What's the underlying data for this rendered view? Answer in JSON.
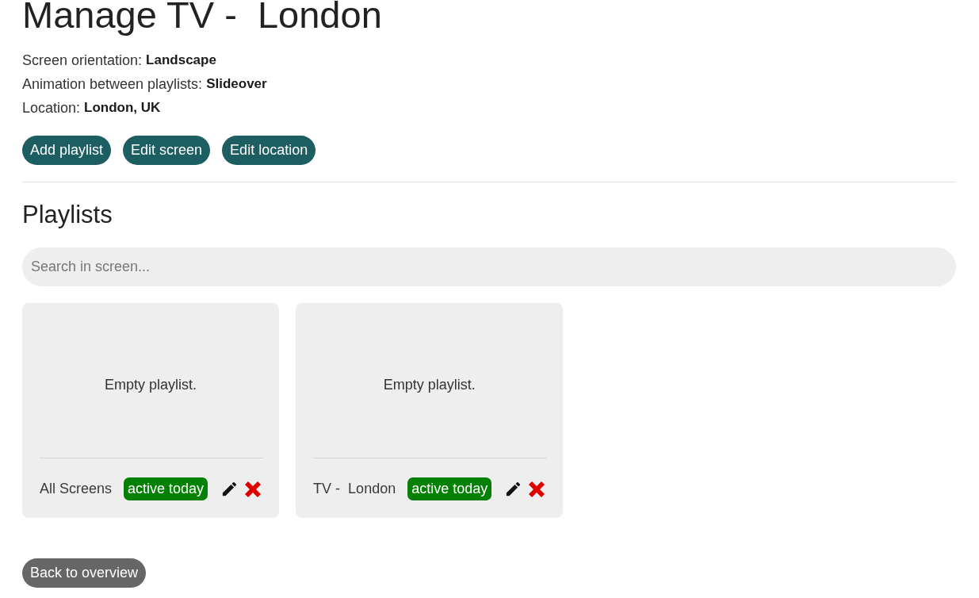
{
  "page": {
    "title": "Manage TV -  London"
  },
  "details": [
    {
      "label": "Screen orientation:",
      "value": "Landscape"
    },
    {
      "label": "Animation between playlists:",
      "value": "Slideover"
    },
    {
      "label": "Location:",
      "value": "London, UK"
    }
  ],
  "actions": [
    "Add playlist",
    "Edit screen",
    "Edit location"
  ],
  "playlists": {
    "heading": "Playlists",
    "search": {
      "placeholder": "Search in screen..."
    },
    "cards": [
      {
        "message": "Empty playlist.",
        "name": "All Screens",
        "badge": "active today"
      },
      {
        "message": "Empty playlist.",
        "name": "TV -  London",
        "badge": "active today"
      }
    ]
  },
  "back_button": "Back to overview"
}
